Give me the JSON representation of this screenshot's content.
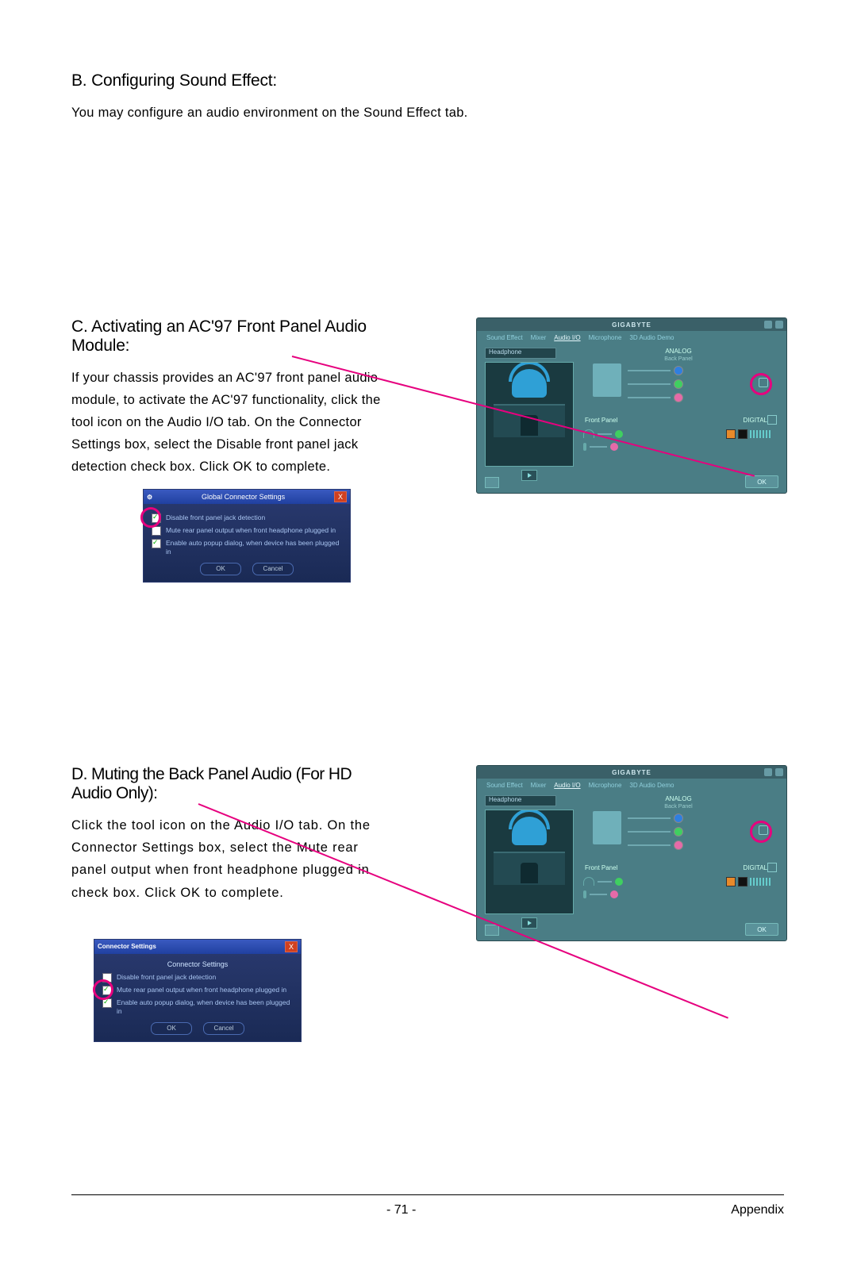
{
  "sectionB": {
    "heading": "B. Configuring Sound Effect:",
    "body": "You may configure an audio environment on the Sound Effect tab."
  },
  "sectionC": {
    "heading": "C. Activating an AC'97 Front Panel Audio Module:",
    "body": "If your chassis provides an AC'97 front panel audio module, to activate the AC'97 functionality, click the tool icon on the Audio I/O tab. On the Connector Settings box, select the Disable front panel jack detection check box. Click OK to complete.",
    "dialog": {
      "title": "Global Connector Settings",
      "opt1": "Disable front panel jack detection",
      "opt2": "Mute rear panel output when front headphone plugged in",
      "opt3": "Enable auto popup dialog, when device has been plugged in",
      "ok": "OK",
      "cancel": "Cancel"
    }
  },
  "sectionD": {
    "heading": "D. Muting the Back Panel Audio (For HD Audio Only):",
    "body": "Click the tool icon on the Audio I/O tab. On the Connector Settings box, select the Mute rear panel output when front headphone plugged in check box. Click OK to complete.",
    "dialog": {
      "titleLeft": "Connector Settings",
      "title": "Connector Settings",
      "opt1": "Disable front panel jack detection",
      "opt2": "Mute rear panel output when front headphone plugged in",
      "opt3": "Enable auto popup dialog, when device has been plugged in",
      "ok": "OK",
      "cancel": "Cancel"
    }
  },
  "audioPanel": {
    "brand": "GIGABYTE",
    "tabs": [
      "Sound Effect",
      "Mixer",
      "Audio I/O",
      "Microphone",
      "3D Audio Demo"
    ],
    "dropdown": "Headphone",
    "analog": "ANALOG",
    "backPanel": "Back Panel",
    "frontPanel": "Front Panel",
    "digital": "DIGITAL",
    "ok": "OK"
  },
  "footer": {
    "page": "- 71 -",
    "section": "Appendix"
  },
  "jackColors": {
    "blue": "#2f7fe0",
    "green": "#3fcf60",
    "pink": "#e66aa8",
    "fgreen": "#3fcf60",
    "fpink": "#e66aa8"
  }
}
